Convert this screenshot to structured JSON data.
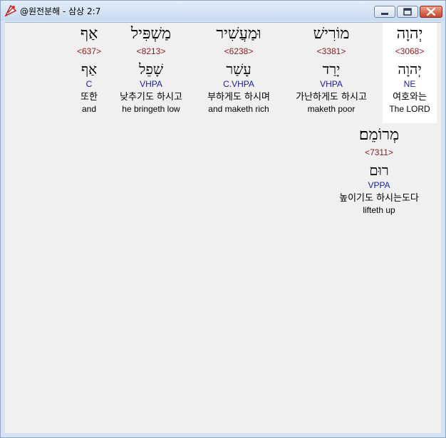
{
  "window": {
    "title": "@원전분해 - 삼상 2:7",
    "icon": "app-icon",
    "controls": [
      "minimize-icon",
      "maximize-icon",
      "close-icon"
    ]
  },
  "colors": {
    "strong_number": "#8b1a1a",
    "grammar_code": "#1c1ca6",
    "highlight_background": "#ffffff"
  },
  "words": [
    {
      "hebrew": "יְהוָה",
      "strong": "<3068>",
      "root": "יְהוָה",
      "grammar": "NE",
      "korean": "여호와는",
      "english": "The LORD",
      "highlighted": true
    },
    {
      "hebrew": "מוֹרִישׁ",
      "strong": "<3381>",
      "root": "יָרַד",
      "grammar": "VHPA",
      "korean": "가난하게도 하시고",
      "english": "maketh poor",
      "highlighted": false
    },
    {
      "hebrew": "וּמַעֲשִׁיר",
      "strong": "<6238>",
      "root": "עָשַׁר",
      "grammar": "C.VHPA",
      "korean": "부하게도 하시며",
      "english": "and maketh rich",
      "highlighted": false
    },
    {
      "hebrew": "מַשְׁפִּיל",
      "strong": "<8213>",
      "root": "שָׁפֵל",
      "grammar": "VHPA",
      "korean": "낮추기도 하시고",
      "english": "he bringeth low",
      "highlighted": false
    },
    {
      "hebrew": "אַף",
      "strong": "<637>",
      "root": "אַף",
      "grammar": "C",
      "korean": "또한",
      "english": "and",
      "highlighted": false
    },
    {
      "hebrew": "מְרוֹמֵם׃",
      "strong": "<7311>",
      "root": "רוּם",
      "grammar": "VPPA",
      "korean": "높이기도 하시는도다",
      "english": "lifteth up",
      "highlighted": false
    }
  ]
}
